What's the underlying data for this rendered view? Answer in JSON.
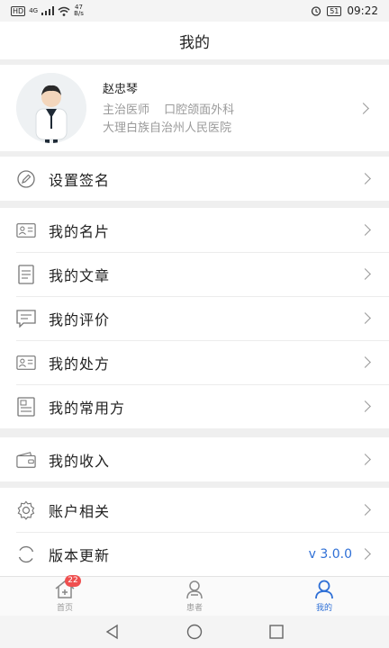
{
  "status_bar": {
    "hd_label": "HD",
    "network": "4G",
    "speed_value": "47",
    "speed_unit": "B/s",
    "battery": "51",
    "time": "09:22"
  },
  "header": {
    "title": "我的"
  },
  "profile": {
    "name": "赵忠琴",
    "title": "主治医师",
    "department": "口腔颌面外科",
    "hospital": "大理白族自治州人民医院"
  },
  "menu": {
    "signature": "设置签名",
    "card": "我的名片",
    "articles": "我的文章",
    "reviews": "我的评价",
    "prescriptions": "我的处方",
    "common_prescriptions": "我的常用方",
    "income": "我的收入",
    "account": "账户相关",
    "update": "版本更新",
    "version": "v 3.0.0"
  },
  "tabbar": {
    "home": "首页",
    "home_badge": "22",
    "patients": "患者",
    "mine": "我的"
  },
  "colors": {
    "accent": "#2e6fd6",
    "badge": "#ef4f4f"
  }
}
